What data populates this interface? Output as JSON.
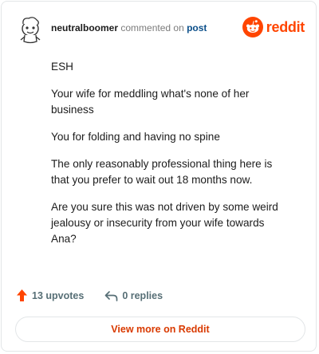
{
  "header": {
    "username": "neutralboomer",
    "action_text": "commented on",
    "post_link": "post",
    "brand_text": "reddit"
  },
  "comment": {
    "paragraphs": [
      "ESH",
      "Your wife for meddling what's none of her business",
      "You for folding and having no spine",
      "The only reasonably professional thing here is that you prefer to wait out 18 months now.",
      "Are you sure this was not driven by some weird jealousy or insecurity from your wife towards Ana?"
    ]
  },
  "actions": {
    "upvotes": "13 upvotes",
    "replies": "0 replies"
  },
  "footer": {
    "view_more": "View more on Reddit"
  },
  "colors": {
    "brand": "#ff4500",
    "upvote": "#ff4500",
    "link": "#0b4f8a",
    "view_more_text": "#d93a00"
  },
  "icons": {
    "avatar": "snoo-avatar",
    "logo": "reddit-logo-icon",
    "upvote": "upvote-arrow-icon",
    "reply": "reply-arrow-icon"
  }
}
